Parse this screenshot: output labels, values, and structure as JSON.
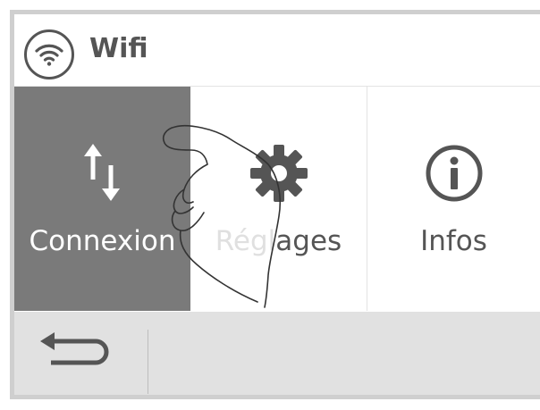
{
  "header": {
    "title": "Wifi",
    "icon": "wifi-icon"
  },
  "tiles": [
    {
      "label": "Connexion",
      "icon": "transfer-arrows-icon",
      "active": true
    },
    {
      "label_faded": "Régl",
      "label_rest": "ages",
      "icon": "gear-icon",
      "active": false
    },
    {
      "label": "Infos",
      "icon": "info-icon",
      "active": false
    }
  ],
  "footer": {
    "back_icon": "back-arrow-icon"
  },
  "colors": {
    "active_tile": "#7a7a7a",
    "text": "#555555",
    "footer_bg": "#e1e1e1"
  }
}
